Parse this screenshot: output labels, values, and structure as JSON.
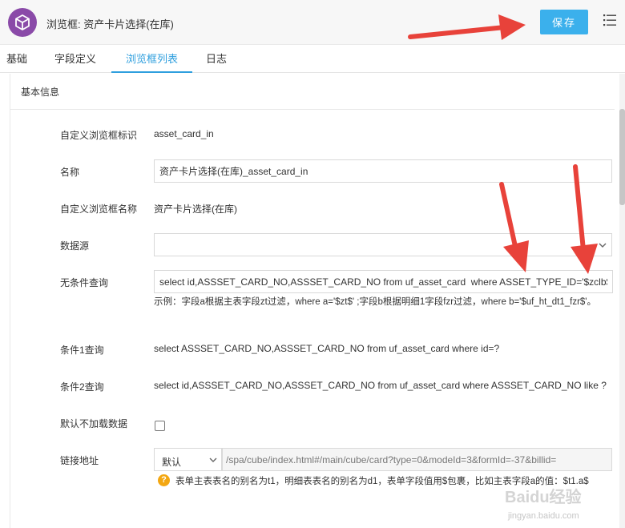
{
  "header": {
    "title": "浏览框: 资产卡片选择(在库)",
    "save_label": "保存"
  },
  "tabs": [
    {
      "label": "基础",
      "active": false
    },
    {
      "label": "字段定义",
      "active": false
    },
    {
      "label": "浏览框列表",
      "active": true
    },
    {
      "label": "日志",
      "active": false
    }
  ],
  "section": {
    "title": "基本信息"
  },
  "form": {
    "identifier": {
      "label": "自定义浏览框标识",
      "value": "asset_card_in"
    },
    "name": {
      "label": "名称",
      "value": "资产卡片选择(在库)_asset_card_in"
    },
    "display_name": {
      "label": "自定义浏览框名称",
      "value": "资产卡片选择(在库)"
    },
    "datasource": {
      "label": "数据源",
      "value": ""
    },
    "unconditional_query": {
      "label": "无条件查询",
      "value": "select id,ASSSET_CARD_NO,ASSSET_CARD_NO from uf_asset_card  where ASSET_TYPE_ID='$zclb$",
      "hint": "示例：字段a根据主表字段zt过滤，where a='$zt$' ;字段b根据明细1字段fzr过滤，where b='$uf_ht_dt1_fzr$'。"
    },
    "condition1": {
      "label": "条件1查询",
      "value": "select ASSSET_CARD_NO,ASSSET_CARD_NO from uf_asset_card where id=?"
    },
    "condition2": {
      "label": "条件2查询",
      "value": "select id,ASSSET_CARD_NO,ASSSET_CARD_NO from uf_asset_card where ASSSET_CARD_NO like ?"
    },
    "no_default_load": {
      "label": "默认不加载数据",
      "checked": false
    },
    "link": {
      "label": "链接地址",
      "mode": "默认",
      "value": "/spa/cube/index.html#/main/cube/card?type=0&modeId=3&formId=-37&billid=",
      "tip": "表单主表表名的别名为t1，明细表表名的别名为d1，表单字段值用$包裹，比如主表字段a的值：$t1.a$"
    }
  },
  "icons": {
    "app": "cube-icon",
    "menu": "list-menu-icon",
    "dropdown": "chevron-down-icon",
    "tip": "question-circle-icon"
  },
  "colors": {
    "primary": "#3bb0ec",
    "tab_active": "#2f9fde",
    "app_icon": "#8a4aa8",
    "tip_icon": "#f3a712",
    "annotation_arrow": "#e8423a"
  },
  "watermark": {
    "brand": "Baidu经验",
    "domain": "jingyan.baidu.com"
  }
}
